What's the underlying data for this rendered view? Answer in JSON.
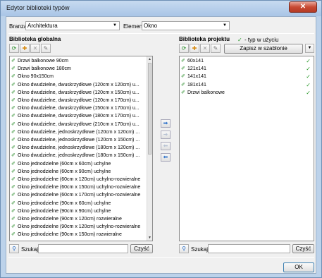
{
  "window": {
    "title": "Edytor biblioteki typów",
    "close_glyph": "✕"
  },
  "filters": {
    "branza_label": "Branza",
    "branza_value": "Architektura",
    "element_label": "Element",
    "element_value": "Okno"
  },
  "global": {
    "title": "Biblioteka globalna",
    "toolbar_icons": [
      "refresh-icon",
      "add-icon",
      "delete-icon",
      "edit-icon"
    ],
    "items": [
      "Drzwi balkonowe 90cm",
      "Drzwi balkonowe 180cm",
      "Okno 90x150cm",
      "Okno dwudzielne, dwuskrzydłowe (120cm x 120cm) u...",
      "Okno dwudzielne, dwuskrzydłowe (120cm x 150cm) u...",
      "Okno dwudzielne, dwuskrzydłowe (120cm x 170cm) u...",
      "Okno dwudzielne, dwuskrzydłowe (150cm x 170cm) u...",
      "Okno dwudzielne, dwuskrzydłowe (180cm x 170cm) u...",
      "Okno dwudzielne, dwuskrzydłowe (210cm x 170cm) u...",
      "Okno dwudzielne, jednoskrzydłowe (120cm x 120cm) ...",
      "Okno dwudzielne, jednoskrzydłowe (120cm x 150cm) ...",
      "Okno dwudzielne, jednoskrzydłowe (180cm x 120cm) ...",
      "Okno dwudzielne, jednoskrzydłowe (180cm x 150cm) ...",
      "Okno jednodzielne (60cm x 60cm) uchylne",
      "Okno jednodzielne (60cm x 90cm) uchylne",
      "Okno jednodzielne (60cm x 120cm) uchylno-rozwieralne",
      "Okno jednodzielne (60cm x 150cm) uchylno-rozwieralne",
      "Okno jednodzielne (60cm x 170cm) uchylno-rozwieralne",
      "Okno jednodzielne (90cm x 60cm) uchylne",
      "Okno jednodzielne (90cm x 90cm) uchylne",
      "Okno jednodzielne (90cm x 120cm) rozwieralne",
      "Okno jednodzielne (90cm x 120cm) uchylno-rozwieralne",
      "Okno jednodzielne (90cm x 150cm) rozwieralne"
    ],
    "search_label": "Szukaj:",
    "search_value": "",
    "clear_label": "Czyść"
  },
  "project": {
    "title": "Biblioteka projektu",
    "legend": "- typ w użyciu",
    "save_template_label": "Zapisz w szablonie",
    "items": [
      {
        "label": "60x141",
        "in_use": true
      },
      {
        "label": "121x141",
        "in_use": true
      },
      {
        "label": "141x141",
        "in_use": true
      },
      {
        "label": "181x141",
        "in_use": true
      },
      {
        "label": "Drzwi balkonowe",
        "in_use": true
      }
    ],
    "search_label": "Szukaj:",
    "search_value": "",
    "clear_label": "Czyść"
  },
  "ok_label": "OK",
  "colors": {
    "accent": "#2a6fc9",
    "check": "#2e9b2e",
    "close": "#c84a33"
  }
}
